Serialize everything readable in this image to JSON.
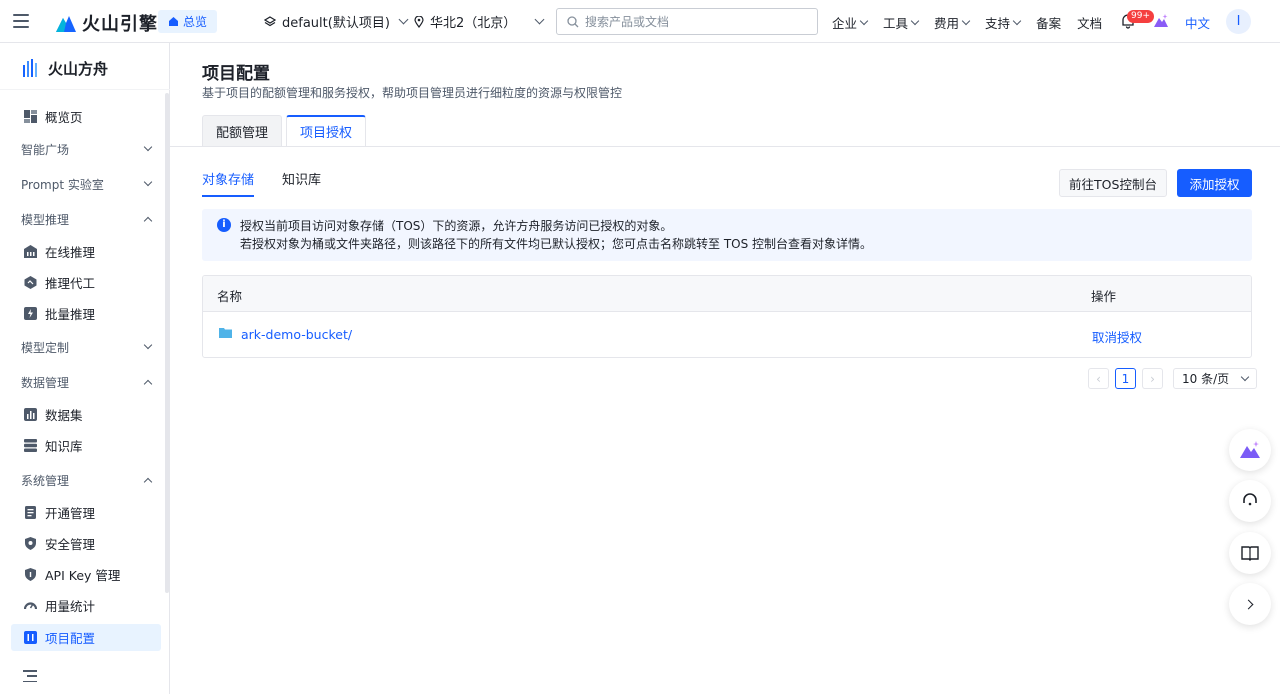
{
  "header": {
    "brand": "火山引擎",
    "home_label": "总览",
    "project": "default(默认项目)",
    "region": "华北2（北京）",
    "search_placeholder": "搜索产品或文档",
    "nav": [
      "企业",
      "工具",
      "费用",
      "支持",
      "备案",
      "文档"
    ],
    "notification_badge": "99+",
    "language": "中文",
    "avatar_initial": "I"
  },
  "sidebar": {
    "brand": "火山方舟",
    "overview": "概览页",
    "groups": {
      "smart_plaza": "智能广场",
      "prompt_lab": "Prompt 实验室",
      "model_inference": "模型推理",
      "model_custom": "模型定制",
      "data_mgmt": "数据管理",
      "system_mgmt": "系统管理"
    },
    "items": {
      "online_inference": "在线推理",
      "inference_agent": "推理代工",
      "batch_inference": "批量推理",
      "dataset": "数据集",
      "knowledge_base": "知识库",
      "service_mgmt": "开通管理",
      "security_mgmt": "安全管理",
      "api_key": "API Key 管理",
      "usage_stats": "用量统计",
      "project_config": "项目配置"
    }
  },
  "main": {
    "title": "项目配置",
    "description": "基于项目的配额管理和服务授权，帮助项目管理员进行细粒度的资源与权限管控",
    "tabs": [
      "配额管理",
      "项目授权"
    ],
    "subtabs": [
      "对象存储",
      "知识库"
    ],
    "btn_tos": "前往TOS控制台",
    "btn_add": "添加授权",
    "notice_line1": "授权当前项目访问对象存储（TOS）下的资源，允许方舟服务访问已授权的对象。",
    "notice_line2": "若授权对象为桶或文件夹路径，则该路径下的所有文件均已默认授权；您可点击名称跳转至 TOS 控制台查看对象详情。",
    "table": {
      "col_name": "名称",
      "col_op": "操作",
      "rows": [
        {
          "name": "ark-demo-bucket/",
          "op": "取消授权"
        }
      ]
    },
    "pager": {
      "current": "1",
      "page_size": "10 条/页"
    }
  },
  "colors": {
    "accent": "#165dff",
    "active_bg": "#e8f3ff",
    "badge": "#f53f3f"
  }
}
